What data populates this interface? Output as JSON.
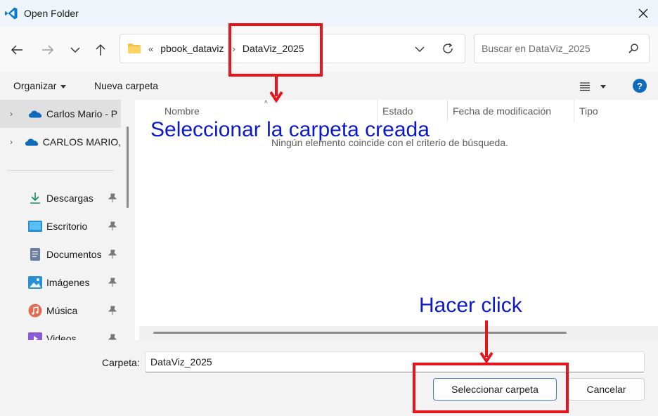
{
  "window": {
    "title": "Open Folder",
    "app_icon": "vscode-icon"
  },
  "nav": {
    "back_icon": "arrow-left-icon",
    "forward_icon": "arrow-right-icon",
    "recent_icon": "chevron-down-icon",
    "up_icon": "arrow-up-icon",
    "breadcrumb": {
      "overflow": "«",
      "items": [
        "pbook_dataviz",
        "DataViz_2025"
      ],
      "separator": "›"
    },
    "search_placeholder": "Buscar en DataViz_2025"
  },
  "commands": {
    "organize": "Organizar",
    "new_folder": "Nueva carpeta",
    "help": "?"
  },
  "sidebar": {
    "roots": [
      {
        "label": "Carlos Mario - P",
        "icon": "onedrive-cloud-icon",
        "selected": true
      },
      {
        "label": "CARLOS MARIO,",
        "icon": "onedrive-cloud-icon",
        "selected": false
      }
    ],
    "quick_access": [
      {
        "label": "Descargas",
        "icon": "download-icon"
      },
      {
        "label": "Escritorio",
        "icon": "desktop-icon"
      },
      {
        "label": "Documentos",
        "icon": "document-icon"
      },
      {
        "label": "Imágenes",
        "icon": "pictures-icon"
      },
      {
        "label": "Música",
        "icon": "music-icon"
      },
      {
        "label": "Videos",
        "icon": "video-icon"
      }
    ]
  },
  "content": {
    "columns": [
      "Nombre",
      "Estado",
      "Fecha de modificación",
      "Tipo"
    ],
    "empty_message": "Ningún elemento coincide con el criterio de búsqueda."
  },
  "footer": {
    "folder_label": "Carpeta:",
    "folder_value": "DataViz_2025",
    "select_button": "Seleccionar carpeta",
    "cancel_button": "Cancelar"
  },
  "annotations": {
    "top_text": "Seleccionar la carpeta creada",
    "bottom_text": "Hacer click",
    "color_box": "#e8141b",
    "color_text": "#0b19c9"
  }
}
